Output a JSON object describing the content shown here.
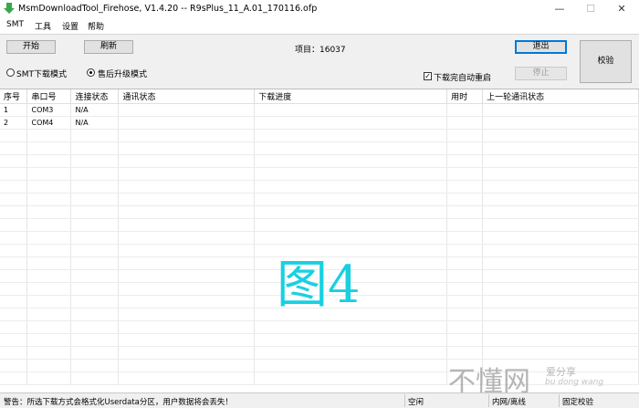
{
  "window": {
    "title": "MsmDownloadTool_Firehose, V1.4.20 -- R9sPlus_11_A.01_170116.ofp",
    "minimize": "—",
    "maximize": "☐",
    "close": "✕"
  },
  "menu": [
    "SMT",
    "工具",
    "设置",
    "帮助"
  ],
  "toolbar": {
    "start_label": "开始",
    "refresh_label": "刷新",
    "project_label": "项目：16037",
    "exit_label": "退出",
    "stop_label": "停止",
    "verify_label": "校验",
    "radio_smt_label": "SMT下载模式",
    "radio_aftersale_label": "售后升级模式",
    "auto_restart_label": "下载完自动重启",
    "auto_restart_checked": true,
    "selected_mode": "aftersale"
  },
  "grid": {
    "columns": [
      "序号",
      "串口号",
      "连接状态",
      "通讯状态",
      "下载进度",
      "用时",
      "上一轮通讯状态"
    ],
    "rows": [
      [
        "1",
        "COM3",
        "N/A",
        "",
        "",
        "",
        ""
      ],
      [
        "2",
        "COM4",
        "N/A",
        "",
        "",
        "",
        ""
      ]
    ]
  },
  "overlay": {
    "text": "图4"
  },
  "statusbar": {
    "warning": "警告：所选下载方式会格式化Userdata分区，用户数据将会丢失！",
    "state": "空闲",
    "network": "内网/离线",
    "verify": "固定校验"
  },
  "watermark": {
    "main": "不懂网",
    "sub": "爱分享",
    "url": "bu dong wang"
  },
  "colors": {
    "overlay": "#19d0e0",
    "accent_border": "#0078d7",
    "app_icon": "#3aa64a"
  }
}
